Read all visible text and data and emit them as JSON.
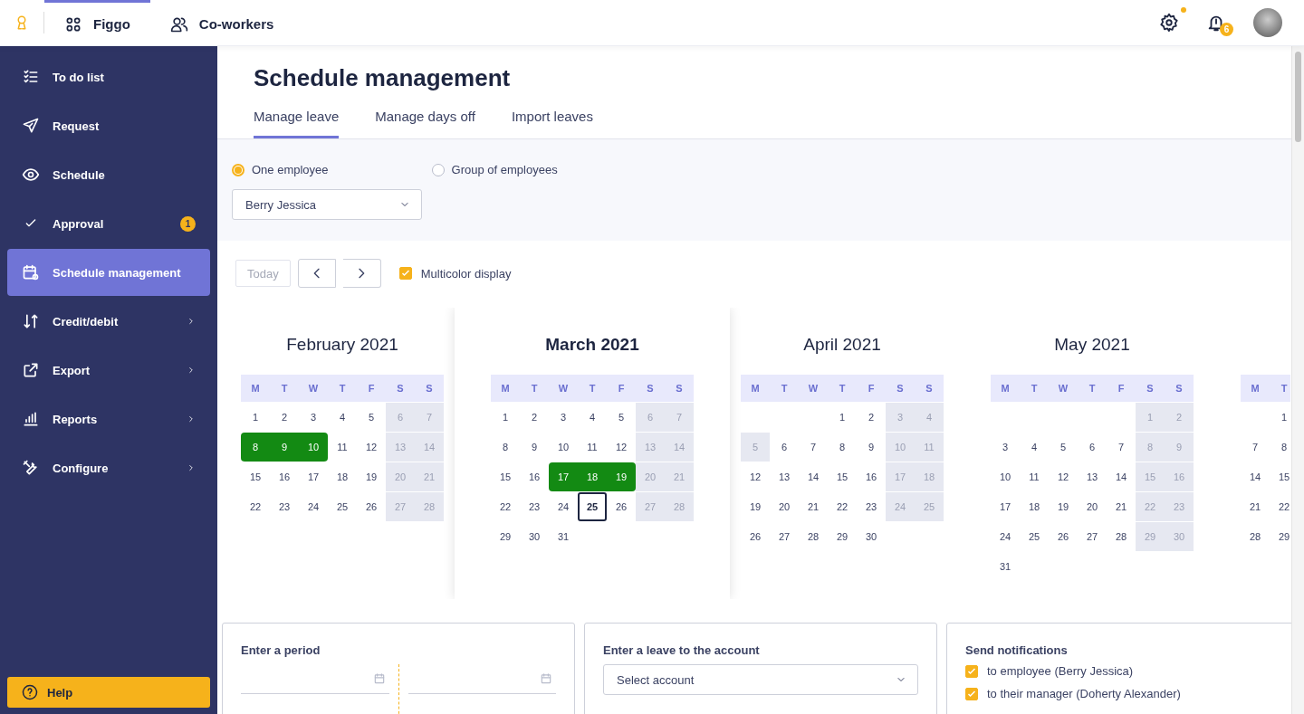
{
  "top_bar": {
    "apps": [
      {
        "label": "Figgo",
        "selected": true
      },
      {
        "label": "Co-workers",
        "selected": false
      }
    ],
    "settings": {
      "alert": true
    },
    "notifications": {
      "count": "6"
    }
  },
  "sidebar": {
    "items": [
      {
        "label": "To do list",
        "selected": false,
        "submenu": false
      },
      {
        "label": "Request",
        "selected": false,
        "submenu": false
      },
      {
        "label": "Schedule",
        "selected": false,
        "submenu": false
      },
      {
        "label": "Approval",
        "selected": false,
        "submenu": false,
        "badge": "1"
      },
      {
        "label": "Schedule management",
        "selected": true,
        "submenu": false
      },
      {
        "label": "Credit/debit",
        "selected": false,
        "submenu": true
      },
      {
        "label": "Export",
        "selected": false,
        "submenu": true
      },
      {
        "label": "Reports",
        "selected": false,
        "submenu": true
      },
      {
        "label": "Configure",
        "selected": false,
        "submenu": true
      }
    ],
    "help": "Help"
  },
  "page": {
    "title": "Schedule management",
    "tabs": [
      {
        "label": "Manage leave",
        "selected": true
      },
      {
        "label": "Manage days off",
        "selected": false
      },
      {
        "label": "Import leaves",
        "selected": false
      }
    ],
    "target": [
      {
        "label": "One employee",
        "selected": true
      },
      {
        "label": "Group of employees",
        "selected": false
      }
    ],
    "employee": "Berry Jessica",
    "today_button": {
      "label": "Today",
      "disabled": true
    },
    "multicolor": {
      "label": "Multicolor display",
      "checked": true
    },
    "months": [
      {
        "title": "February 2021",
        "selected": false,
        "weekdays": [
          "M",
          "T",
          "W",
          "T",
          "F",
          "S",
          "S"
        ],
        "weeks": [
          [
            {
              "day": "1",
              "off": false,
              "leave": false,
              "today": false
            },
            {
              "day": "2",
              "off": false,
              "leave": false,
              "today": false
            },
            {
              "day": "3",
              "off": false,
              "leave": false,
              "today": false
            },
            {
              "day": "4",
              "off": false,
              "leave": false,
              "today": false
            },
            {
              "day": "5",
              "off": false,
              "leave": false,
              "today": false
            },
            {
              "day": "6",
              "off": true,
              "leave": false,
              "today": false
            },
            {
              "day": "7",
              "off": true,
              "leave": false,
              "today": false
            }
          ],
          [
            {
              "day": "8",
              "off": false,
              "leave": true,
              "today": false
            },
            {
              "day": "9",
              "off": false,
              "leave": true,
              "today": false
            },
            {
              "day": "10",
              "off": false,
              "leave": true,
              "today": false
            },
            {
              "day": "11",
              "off": false,
              "leave": false,
              "today": false
            },
            {
              "day": "12",
              "off": false,
              "leave": false,
              "today": false
            },
            {
              "day": "13",
              "off": true,
              "leave": false,
              "today": false
            },
            {
              "day": "14",
              "off": true,
              "leave": false,
              "today": false
            }
          ],
          [
            {
              "day": "15",
              "off": false,
              "leave": false,
              "today": false
            },
            {
              "day": "16",
              "off": false,
              "leave": false,
              "today": false
            },
            {
              "day": "17",
              "off": false,
              "leave": false,
              "today": false
            },
            {
              "day": "18",
              "off": false,
              "leave": false,
              "today": false
            },
            {
              "day": "19",
              "off": false,
              "leave": false,
              "today": false
            },
            {
              "day": "20",
              "off": true,
              "leave": false,
              "today": false
            },
            {
              "day": "21",
              "off": true,
              "leave": false,
              "today": false
            }
          ],
          [
            {
              "day": "22",
              "off": false,
              "leave": false,
              "today": false
            },
            {
              "day": "23",
              "off": false,
              "leave": false,
              "today": false
            },
            {
              "day": "24",
              "off": false,
              "leave": false,
              "today": false
            },
            {
              "day": "25",
              "off": false,
              "leave": false,
              "today": false
            },
            {
              "day": "26",
              "off": false,
              "leave": false,
              "today": false
            },
            {
              "day": "27",
              "off": true,
              "leave": false,
              "today": false
            },
            {
              "day": "28",
              "off": true,
              "leave": false,
              "today": false
            }
          ]
        ]
      },
      {
        "title": "March 2021",
        "selected": true,
        "weekdays": [
          "M",
          "T",
          "W",
          "T",
          "F",
          "S",
          "S"
        ],
        "weeks": [
          [
            {
              "day": "1",
              "off": false,
              "leave": false,
              "today": false
            },
            {
              "day": "2",
              "off": false,
              "leave": false,
              "today": false
            },
            {
              "day": "3",
              "off": false,
              "leave": false,
              "today": false
            },
            {
              "day": "4",
              "off": false,
              "leave": false,
              "today": false
            },
            {
              "day": "5",
              "off": false,
              "leave": false,
              "today": false
            },
            {
              "day": "6",
              "off": true,
              "leave": false,
              "today": false
            },
            {
              "day": "7",
              "off": true,
              "leave": false,
              "today": false
            }
          ],
          [
            {
              "day": "8",
              "off": false,
              "leave": false,
              "today": false
            },
            {
              "day": "9",
              "off": false,
              "leave": false,
              "today": false
            },
            {
              "day": "10",
              "off": false,
              "leave": false,
              "today": false
            },
            {
              "day": "11",
              "off": false,
              "leave": false,
              "today": false
            },
            {
              "day": "12",
              "off": false,
              "leave": false,
              "today": false
            },
            {
              "day": "13",
              "off": true,
              "leave": false,
              "today": false
            },
            {
              "day": "14",
              "off": true,
              "leave": false,
              "today": false
            }
          ],
          [
            {
              "day": "15",
              "off": false,
              "leave": false,
              "today": false
            },
            {
              "day": "16",
              "off": false,
              "leave": false,
              "today": false
            },
            {
              "day": "17",
              "off": false,
              "leave": true,
              "today": false
            },
            {
              "day": "18",
              "off": false,
              "leave": true,
              "today": false
            },
            {
              "day": "19",
              "off": false,
              "leave": true,
              "today": false
            },
            {
              "day": "20",
              "off": true,
              "leave": false,
              "today": false
            },
            {
              "day": "21",
              "off": true,
              "leave": false,
              "today": false
            }
          ],
          [
            {
              "day": "22",
              "off": false,
              "leave": false,
              "today": false
            },
            {
              "day": "23",
              "off": false,
              "leave": false,
              "today": false
            },
            {
              "day": "24",
              "off": false,
              "leave": false,
              "today": false
            },
            {
              "day": "25",
              "off": false,
              "leave": false,
              "today": true
            },
            {
              "day": "26",
              "off": false,
              "leave": false,
              "today": false
            },
            {
              "day": "27",
              "off": true,
              "leave": false,
              "today": false
            },
            {
              "day": "28",
              "off": true,
              "leave": false,
              "today": false
            }
          ],
          [
            {
              "day": "29",
              "off": false,
              "leave": false,
              "today": false
            },
            {
              "day": "30",
              "off": false,
              "leave": false,
              "today": false
            },
            {
              "day": "31",
              "off": false,
              "leave": false,
              "today": false
            }
          ]
        ]
      },
      {
        "title": "April 2021",
        "selected": false,
        "weekdays": [
          "M",
          "T",
          "W",
          "T",
          "F",
          "S",
          "S"
        ],
        "weeks": [
          [
            {
              "day": "1",
              "off": false,
              "leave": false,
              "today": false
            },
            {
              "day": "2",
              "off": false,
              "leave": false,
              "today": false
            },
            {
              "day": "3",
              "off": true,
              "leave": false,
              "today": false
            },
            {
              "day": "4",
              "off": true,
              "leave": false,
              "today": false
            }
          ],
          [
            {
              "day": "5",
              "off": true,
              "leave": false,
              "today": false
            },
            {
              "day": "6",
              "off": false,
              "leave": false,
              "today": false
            },
            {
              "day": "7",
              "off": false,
              "leave": false,
              "today": false
            },
            {
              "day": "8",
              "off": false,
              "leave": false,
              "today": false
            },
            {
              "day": "9",
              "off": false,
              "leave": false,
              "today": false
            },
            {
              "day": "10",
              "off": true,
              "leave": false,
              "today": false
            },
            {
              "day": "11",
              "off": true,
              "leave": false,
              "today": false
            }
          ],
          [
            {
              "day": "12",
              "off": false,
              "leave": false,
              "today": false
            },
            {
              "day": "13",
              "off": false,
              "leave": false,
              "today": false
            },
            {
              "day": "14",
              "off": false,
              "leave": false,
              "today": false
            },
            {
              "day": "15",
              "off": false,
              "leave": false,
              "today": false
            },
            {
              "day": "16",
              "off": false,
              "leave": false,
              "today": false
            },
            {
              "day": "17",
              "off": true,
              "leave": false,
              "today": false
            },
            {
              "day": "18",
              "off": true,
              "leave": false,
              "today": false
            }
          ],
          [
            {
              "day": "19",
              "off": false,
              "leave": false,
              "today": false
            },
            {
              "day": "20",
              "off": false,
              "leave": false,
              "today": false
            },
            {
              "day": "21",
              "off": false,
              "leave": false,
              "today": false
            },
            {
              "day": "22",
              "off": false,
              "leave": false,
              "today": false
            },
            {
              "day": "23",
              "off": false,
              "leave": false,
              "today": false
            },
            {
              "day": "24",
              "off": true,
              "leave": false,
              "today": false
            },
            {
              "day": "25",
              "off": true,
              "leave": false,
              "today": false
            }
          ],
          [
            {
              "day": "26",
              "off": false,
              "leave": false,
              "today": false
            },
            {
              "day": "27",
              "off": false,
              "leave": false,
              "today": false
            },
            {
              "day": "28",
              "off": false,
              "leave": false,
              "today": false
            },
            {
              "day": "29",
              "off": false,
              "leave": false,
              "today": false
            },
            {
              "day": "30",
              "off": false,
              "leave": false,
              "today": false
            }
          ]
        ]
      },
      {
        "title": "May 2021",
        "selected": false,
        "weekdays": [
          "M",
          "T",
          "W",
          "T",
          "F",
          "S",
          "S"
        ],
        "weeks": [
          [
            {
              "day": "1",
              "off": true,
              "leave": false,
              "today": false
            },
            {
              "day": "2",
              "off": true,
              "leave": false,
              "today": false
            }
          ],
          [
            {
              "day": "3",
              "off": false,
              "leave": false,
              "today": false
            },
            {
              "day": "4",
              "off": false,
              "leave": false,
              "today": false
            },
            {
              "day": "5",
              "off": false,
              "leave": false,
              "today": false
            },
            {
              "day": "6",
              "off": false,
              "leave": false,
              "today": false
            },
            {
              "day": "7",
              "off": false,
              "leave": false,
              "today": false
            },
            {
              "day": "8",
              "off": true,
              "leave": false,
              "today": false
            },
            {
              "day": "9",
              "off": true,
              "leave": false,
              "today": false
            }
          ],
          [
            {
              "day": "10",
              "off": false,
              "leave": false,
              "today": false
            },
            {
              "day": "11",
              "off": false,
              "leave": false,
              "today": false
            },
            {
              "day": "12",
              "off": false,
              "leave": false,
              "today": false
            },
            {
              "day": "13",
              "off": false,
              "leave": false,
              "today": false
            },
            {
              "day": "14",
              "off": false,
              "leave": false,
              "today": false
            },
            {
              "day": "15",
              "off": true,
              "leave": false,
              "today": false
            },
            {
              "day": "16",
              "off": true,
              "leave": false,
              "today": false
            }
          ],
          [
            {
              "day": "17",
              "off": false,
              "leave": false,
              "today": false
            },
            {
              "day": "18",
              "off": false,
              "leave": false,
              "today": false
            },
            {
              "day": "19",
              "off": false,
              "leave": false,
              "today": false
            },
            {
              "day": "20",
              "off": false,
              "leave": false,
              "today": false
            },
            {
              "day": "21",
              "off": false,
              "leave": false,
              "today": false
            },
            {
              "day": "22",
              "off": true,
              "leave": false,
              "today": false
            },
            {
              "day": "23",
              "off": true,
              "leave": false,
              "today": false
            }
          ],
          [
            {
              "day": "24",
              "off": false,
              "leave": false,
              "today": false
            },
            {
              "day": "25",
              "off": false,
              "leave": false,
              "today": false
            },
            {
              "day": "26",
              "off": false,
              "leave": false,
              "today": false
            },
            {
              "day": "27",
              "off": false,
              "leave": false,
              "today": false
            },
            {
              "day": "28",
              "off": false,
              "leave": false,
              "today": false
            },
            {
              "day": "29",
              "off": true,
              "leave": false,
              "today": false
            },
            {
              "day": "30",
              "off": true,
              "leave": false,
              "today": false
            }
          ],
          [
            {
              "day": "31",
              "off": false,
              "leave": false,
              "today": false
            }
          ]
        ]
      },
      {
        "weekdays": [
          "M",
          "T"
        ],
        "weeks": [
          [
            {
              "day": "1",
              "off": false,
              "leave": false,
              "today": false
            }
          ],
          [
            {
              "day": "7",
              "off": false,
              "leave": false,
              "today": false
            },
            {
              "day": "8",
              "off": false,
              "leave": false,
              "today": false
            }
          ],
          [
            {
              "day": "14",
              "off": false,
              "leave": false,
              "today": false
            },
            {
              "day": "15",
              "off": false,
              "leave": false,
              "today": false
            }
          ],
          [
            {
              "day": "21",
              "off": false,
              "leave": false,
              "today": false
            },
            {
              "day": "22",
              "off": false,
              "leave": false,
              "today": false
            }
          ],
          [
            {
              "day": "28",
              "off": false,
              "leave": false,
              "today": false
            },
            {
              "day": "29",
              "off": false,
              "leave": false,
              "today": false
            }
          ]
        ]
      }
    ],
    "period": {
      "title": "Enter a period"
    },
    "account": {
      "title": "Enter a leave to the account",
      "placeholder": "Select account"
    },
    "notifications": {
      "title": "Send notifications",
      "options": [
        {
          "label": "to employee (Berry Jessica)",
          "checked": true
        },
        {
          "label": "to their manager (Doherty Alexander)",
          "checked": true
        }
      ]
    }
  }
}
